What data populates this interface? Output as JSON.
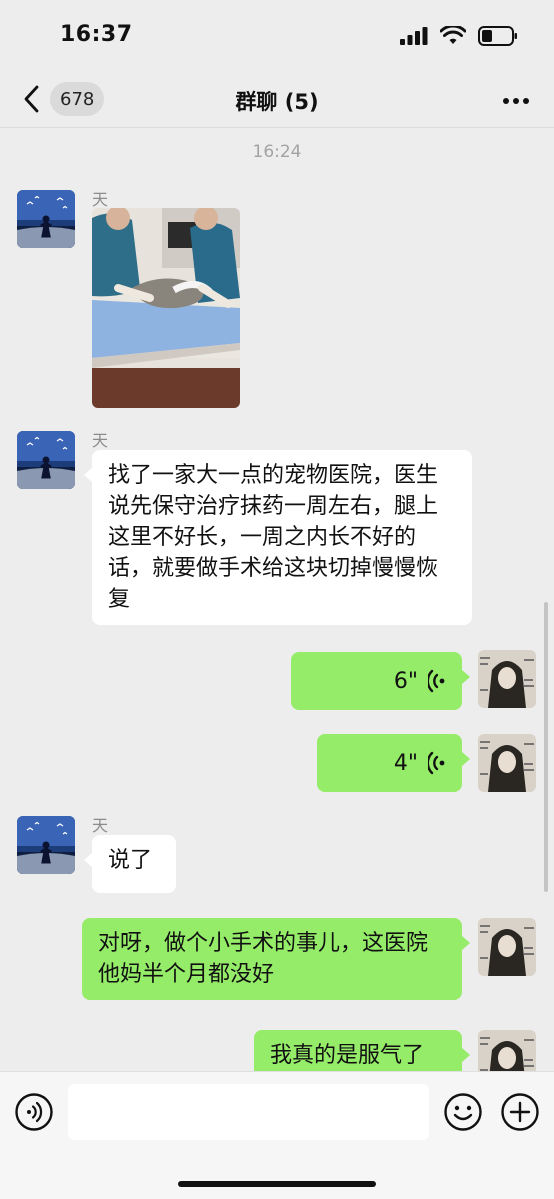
{
  "status_bar": {
    "time": "16:37"
  },
  "header": {
    "back_count": "678",
    "title": "群聊 (5)"
  },
  "timestamp": "16:24",
  "messages": [
    {
      "sender": "天",
      "type": "image"
    },
    {
      "sender": "天",
      "text": "找了一家大一点的宠物医院，医生说先保守治疗抹药一周左右，腿上这里不好长，一周之内长不好的话，就要做手术给这块切掉慢慢恢复"
    },
    {
      "type": "voice",
      "duration": "6\""
    },
    {
      "type": "voice",
      "duration": "4\""
    },
    {
      "sender": "天",
      "text": "说了"
    },
    {
      "text": "对呀，做个小手术的事儿，这医院他妈半个月都没好"
    },
    {
      "text": "我真的是服气了"
    }
  ],
  "colors": {
    "bubble_self": "#95ec69",
    "bubble_other": "#ffffff",
    "background": "#ededed"
  },
  "icons": {
    "back": "chevron-left-icon",
    "more": "more-icon",
    "voice_input": "voice-input-icon",
    "emoji": "emoji-icon",
    "plus": "plus-icon",
    "voice_wave": "voice-wave-icon"
  }
}
